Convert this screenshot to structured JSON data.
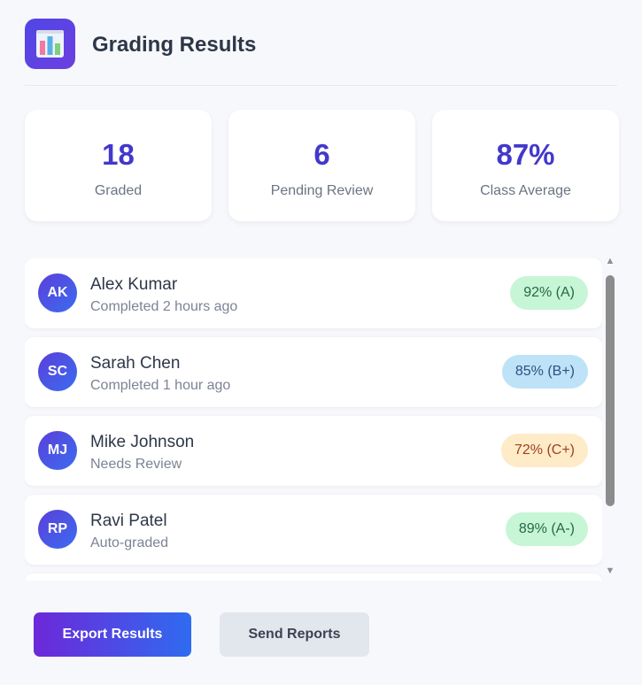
{
  "header": {
    "title": "Grading Results",
    "icon": "bar-chart-icon"
  },
  "stats": [
    {
      "value": "18",
      "label": "Graded"
    },
    {
      "value": "6",
      "label": "Pending Review"
    },
    {
      "value": "87%",
      "label": "Class Average"
    }
  ],
  "students": [
    {
      "initials": "AK",
      "name": "Alex Kumar",
      "status": "Completed 2 hours ago",
      "grade": "92% (A)",
      "grade_bg": "#c6f6d5",
      "grade_color": "#276749"
    },
    {
      "initials": "SC",
      "name": "Sarah Chen",
      "status": "Completed 1 hour ago",
      "grade": "85% (B+)",
      "grade_bg": "#bee3f8",
      "grade_color": "#2c5282"
    },
    {
      "initials": "MJ",
      "name": "Mike Johnson",
      "status": "Needs Review",
      "grade": "72% (C+)",
      "grade_bg": "#feebc8",
      "grade_color": "#9c4221"
    },
    {
      "initials": "RP",
      "name": "Ravi Patel",
      "status": "Auto-graded",
      "grade": "89% (A-)",
      "grade_bg": "#c6f6d5",
      "grade_color": "#276749"
    }
  ],
  "actions": {
    "export_label": "Export Results",
    "send_label": "Send Reports"
  },
  "colors": {
    "accent": "#4338ca",
    "primary_gradient_start": "#6d28d9",
    "primary_gradient_end": "#2f6bf0"
  }
}
